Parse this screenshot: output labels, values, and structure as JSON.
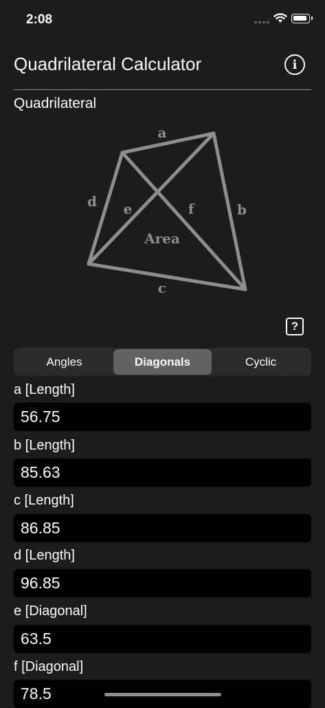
{
  "status_bar": {
    "time": "2:08"
  },
  "header": {
    "title": "Quadrilateral Calculator",
    "info_icon": "info-circle-icon"
  },
  "section": {
    "label": "Quadrilateral"
  },
  "diagram": {
    "labels": {
      "a": "a",
      "b": "b",
      "c": "c",
      "d": "d",
      "e": "e",
      "f": "f",
      "area": "Area"
    },
    "stroke_color": "#8e8e8e",
    "help_label": "?"
  },
  "tabs": [
    {
      "label": "Angles",
      "active": false
    },
    {
      "label": "Diagonals",
      "active": true
    },
    {
      "label": "Cyclic",
      "active": false
    }
  ],
  "fields": [
    {
      "label": "a [Length]",
      "value": "56.75"
    },
    {
      "label": "b [Length]",
      "value": "85.63"
    },
    {
      "label": "c [Length]",
      "value": "86.85"
    },
    {
      "label": "d [Length]",
      "value": "96.85"
    },
    {
      "label": "e [Diagonal]",
      "value": "63.5"
    },
    {
      "label": "f [Diagonal]",
      "value": "78.5"
    }
  ]
}
